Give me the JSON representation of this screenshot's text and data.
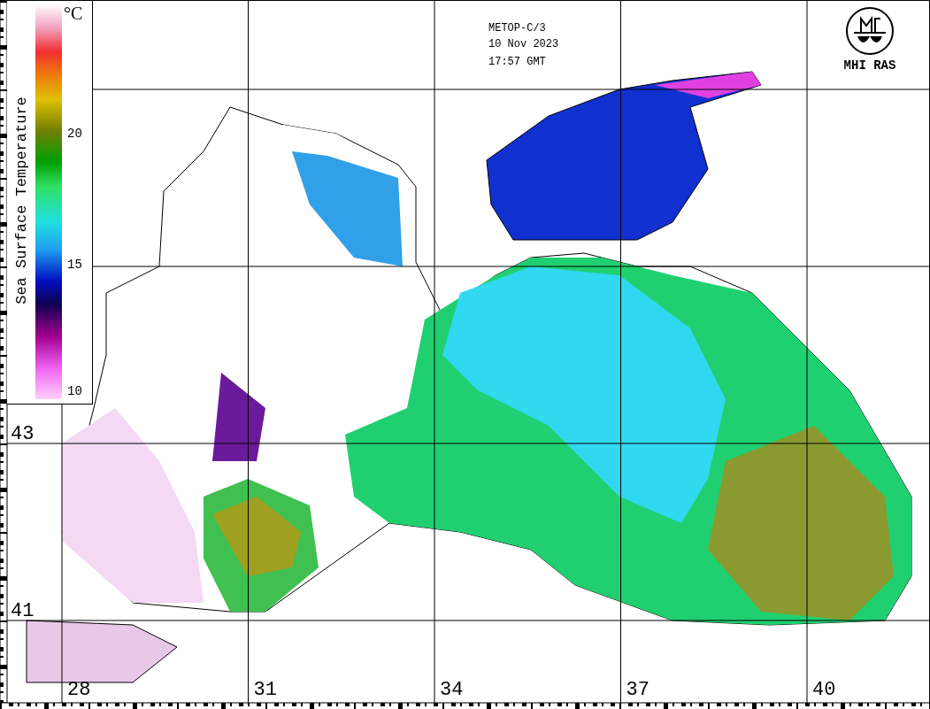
{
  "header": {
    "satellite": "METOP-C/3",
    "date": "10 Nov 2023",
    "time": "17:57 GMT"
  },
  "logo": {
    "label": "MHI RAS"
  },
  "legend": {
    "title": "Sea Surface Temperature",
    "unit": "°C",
    "ticks": [
      "20",
      "15",
      "10"
    ]
  },
  "latitudes": [
    "43",
    "41"
  ],
  "longitudes": [
    "28",
    "31",
    "34",
    "37",
    "40"
  ]
}
